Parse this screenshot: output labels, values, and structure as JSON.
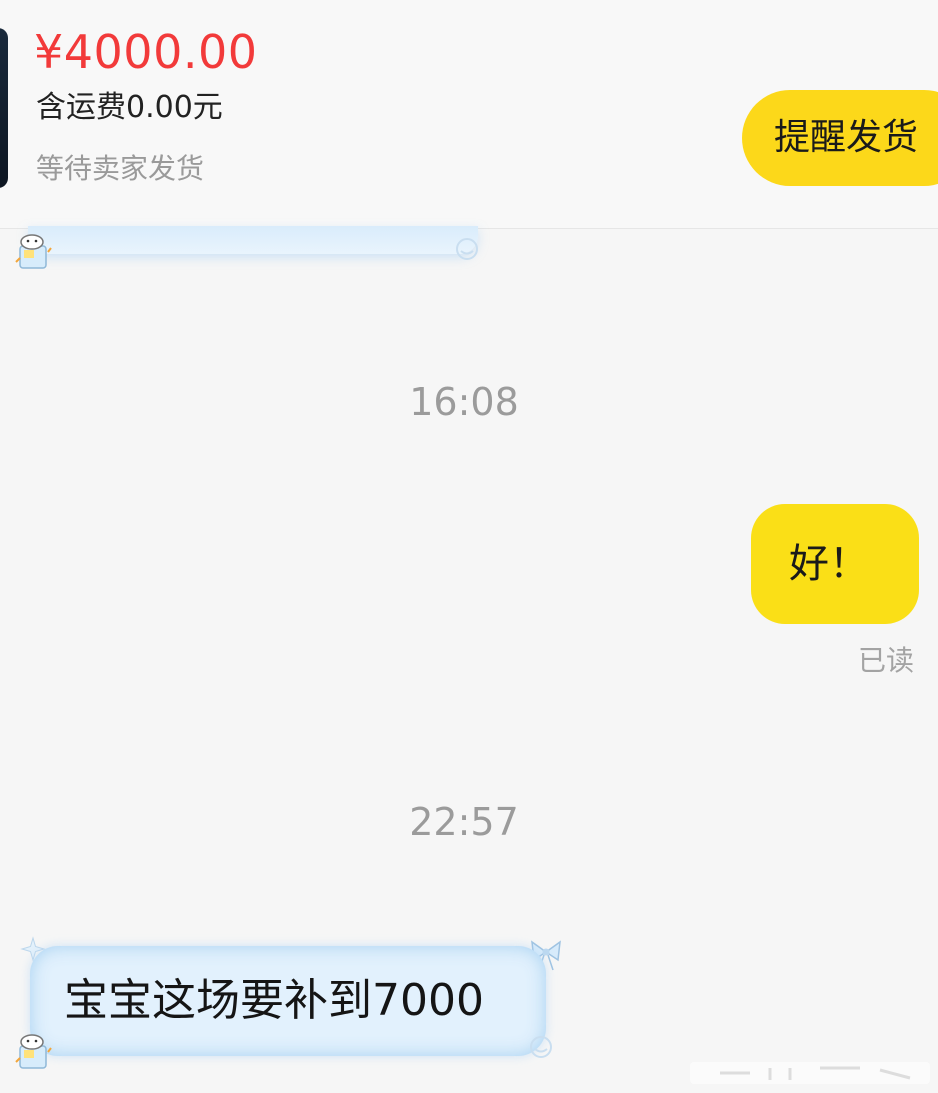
{
  "order": {
    "price": "¥4000.00",
    "shipping": "含运费0.00元",
    "status": "等待卖家发货",
    "remind_button": "提醒发货"
  },
  "messages": [
    {
      "type": "timestamp",
      "text": "16:08"
    },
    {
      "type": "outgoing",
      "text": "好！",
      "read_status": "已读"
    },
    {
      "type": "timestamp",
      "text": "22:57"
    },
    {
      "type": "incoming",
      "text": "宝宝这场要补到7000"
    }
  ],
  "colors": {
    "price": "#f23a3a",
    "accent_yellow": "#fadf17",
    "incoming_bubble": "#e2f1fd"
  },
  "icons": [
    "hamster-sticker-icon",
    "bow-icon",
    "star-icon",
    "swirl-icon"
  ]
}
